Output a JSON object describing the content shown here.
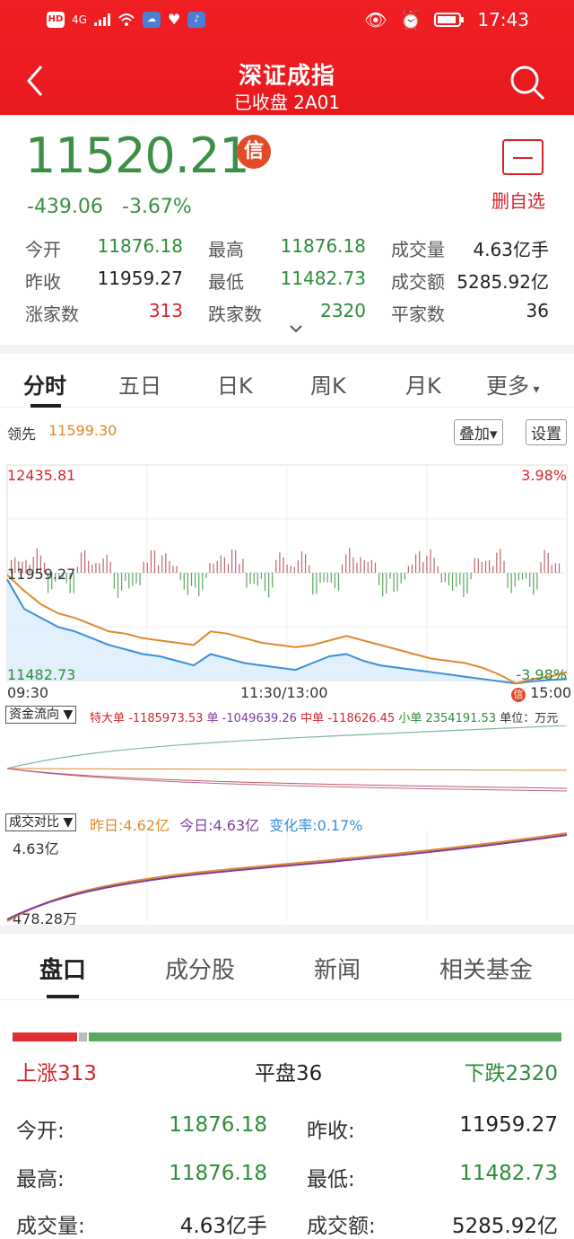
{
  "status": {
    "time": "17:43",
    "hd": "HD",
    "net": "4G"
  },
  "header": {
    "title": "深证成指",
    "subtitle": "已收盘 2A01"
  },
  "quote": {
    "price": "11520.21",
    "xin": "信",
    "change": "-439.06",
    "change_pct": "-3.67%",
    "del_label": "删自选"
  },
  "stats": [
    [
      {
        "k": "今开",
        "v": "11876.18",
        "c": "g"
      },
      {
        "k": "最高",
        "v": "11876.18",
        "c": "g"
      },
      {
        "k": "成交量",
        "v": "4.63亿手",
        "c": "n"
      }
    ],
    [
      {
        "k": "昨收",
        "v": "11959.27",
        "c": "n"
      },
      {
        "k": "最低",
        "v": "11482.73",
        "c": "g"
      },
      {
        "k": "成交额",
        "v": "5285.92亿",
        "c": "n"
      }
    ],
    [
      {
        "k": "涨家数",
        "v": "313",
        "c": "r"
      },
      {
        "k": "跌家数",
        "v": "2320",
        "c": "g"
      },
      {
        "k": "平家数",
        "v": "36",
        "c": "n"
      }
    ]
  ],
  "tabs": [
    "分时",
    "五日",
    "日K",
    "周K",
    "月K",
    "更多"
  ],
  "lead": {
    "label": "领先",
    "value": "11599.30"
  },
  "buttons": {
    "overlay": "叠加▾",
    "settings": "设置"
  },
  "chart_labels": {
    "high": "12435.81",
    "high_pct": "3.98%",
    "mid": "11959.27",
    "low": "11482.73",
    "low_pct": "-3.98%",
    "t0": "09:30",
    "t1": "11:30/13:00",
    "t2": "15:00"
  },
  "fundflow": {
    "label": "资金流向",
    "super": "特大单 -1185973.53",
    "big": "单 -1049639.26",
    "mid": "中单 -118626.45",
    "small": "小单 2354191.53",
    "unit": "单位：万元"
  },
  "volcmp": {
    "label": "成交对比",
    "yday": "昨日:4.62亿",
    "today": "今日:4.63亿",
    "rate": "变化率:0.17%",
    "top": "4.63亿",
    "bottom": "478.28万"
  },
  "bottom_tabs": [
    "盘口",
    "成分股",
    "新闻",
    "相关基金"
  ],
  "breadth": {
    "up": "上涨313",
    "flat": "平盘36",
    "down": "下跌2320",
    "up_frac": 0.118,
    "flat_frac": 0.014
  },
  "details": [
    [
      {
        "k": "今开:",
        "v": "11876.18",
        "c": "g"
      },
      {
        "k": "昨收:",
        "v": "11959.27",
        "c": "n"
      }
    ],
    [
      {
        "k": "最高:",
        "v": "11876.18",
        "c": "g"
      },
      {
        "k": "最低:",
        "v": "11482.73",
        "c": "g"
      }
    ],
    [
      {
        "k": "成交量:",
        "v": "4.63亿手",
        "c": "n"
      },
      {
        "k": "成交额:",
        "v": "5285.92亿",
        "c": "n"
      }
    ]
  ],
  "colors": {
    "red": "#e8191e",
    "green": "#3d8f45",
    "orange": "#e0892c",
    "blue": "#3a8fd8"
  },
  "chart_data": {
    "type": "line",
    "ylim": [
      11482.73,
      12435.81
    ],
    "x": [
      "09:30",
      "11:30/13:00",
      "15:00"
    ],
    "series": [
      {
        "values": [
          11950,
          11880,
          11820,
          11780,
          11760,
          11730,
          11700,
          11690,
          11670,
          11660,
          11650,
          11640,
          11700,
          11690,
          11670,
          11650,
          11640,
          11630,
          11640,
          11660,
          11680,
          11660,
          11640,
          11620,
          11600,
          11580,
          11570,
          11560,
          11540,
          11510,
          11470,
          11490,
          11500,
          11520
        ]
      },
      {
        "values": [
          11930,
          11800,
          11760,
          11720,
          11700,
          11670,
          11640,
          11620,
          11600,
          11590,
          11570,
          11550,
          11600,
          11580,
          11560,
          11550,
          11540,
          11530,
          11560,
          11590,
          11600,
          11570,
          11550,
          11540,
          11530,
          11520,
          11510,
          11500,
          11490,
          11480,
          11470,
          11480,
          11485,
          11490
        ]
      }
    ]
  }
}
